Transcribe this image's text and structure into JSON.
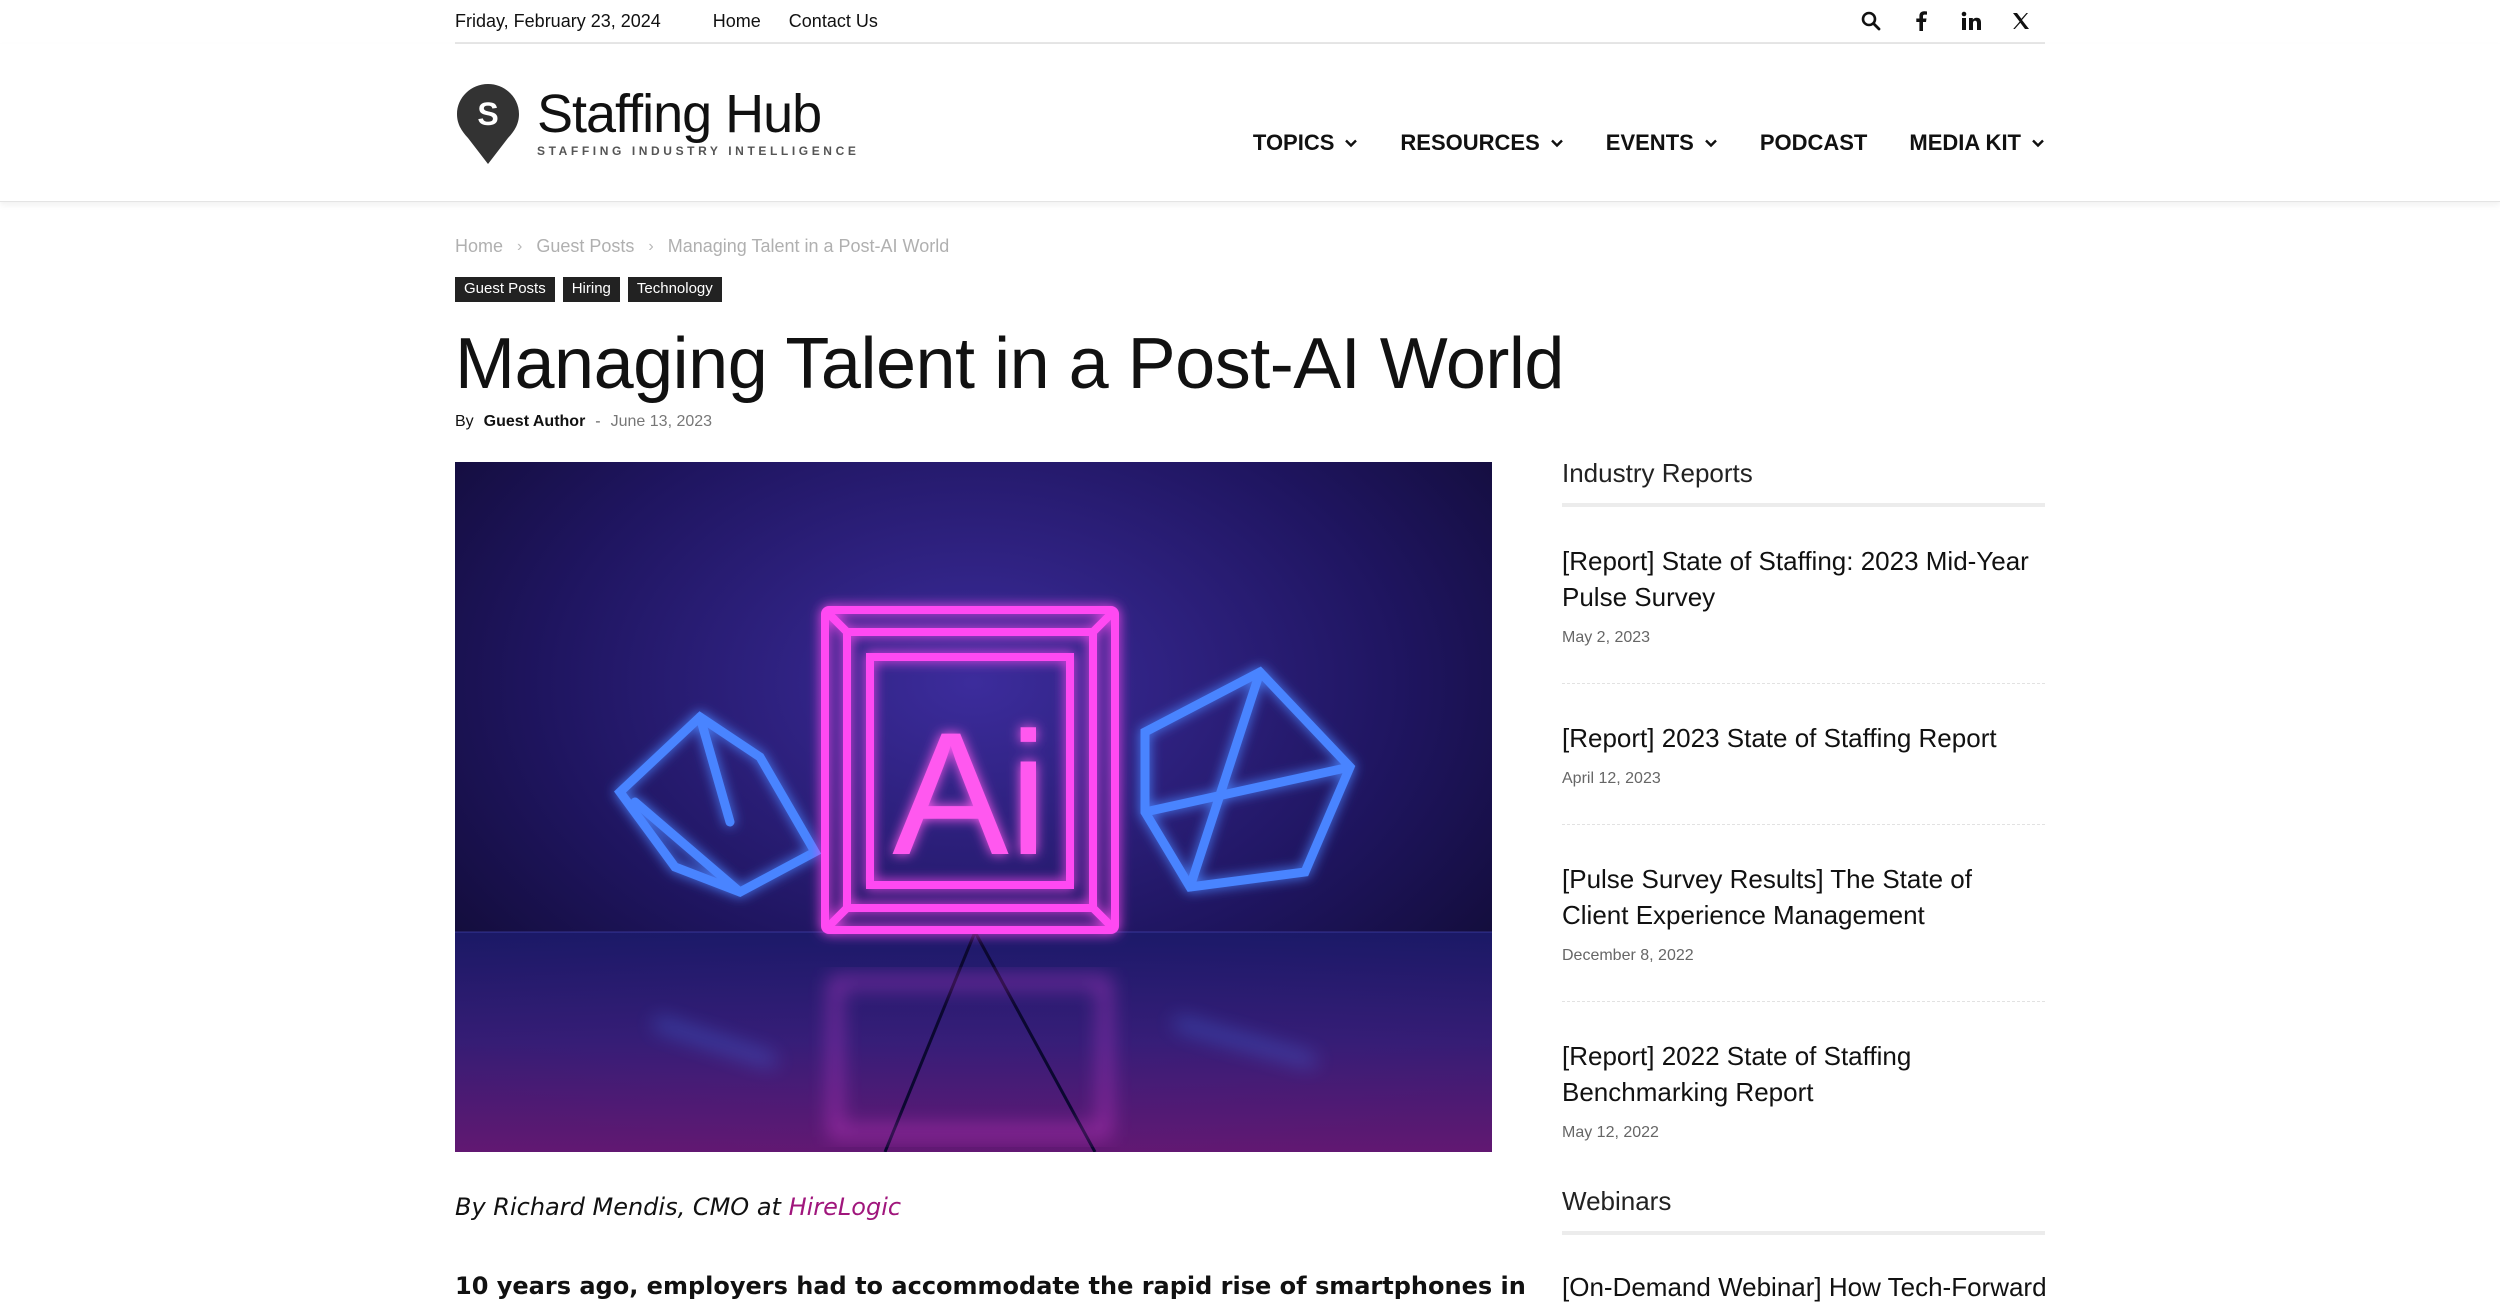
{
  "topbar": {
    "date": "Friday, February 23, 2024",
    "links": [
      "Home",
      "Contact Us"
    ],
    "social_icons": [
      "search-icon",
      "facebook-icon",
      "linkedin-icon",
      "x-icon"
    ]
  },
  "header": {
    "logo_letter": "S",
    "logo_name": "Staffing Hub",
    "logo_tagline": "STAFFING INDUSTRY INTELLIGENCE",
    "nav": [
      {
        "label": "TOPICS",
        "dropdown": true
      },
      {
        "label": "RESOURCES",
        "dropdown": true
      },
      {
        "label": "EVENTS",
        "dropdown": true
      },
      {
        "label": "PODCAST",
        "dropdown": false
      },
      {
        "label": "MEDIA KIT",
        "dropdown": true
      }
    ]
  },
  "breadcrumb": [
    "Home",
    "Guest Posts",
    "Managing Talent in a Post-AI World"
  ],
  "tags": [
    "Guest Posts",
    "Hiring",
    "Technology"
  ],
  "article": {
    "title": "Managing Talent in a Post-AI World",
    "by": "By",
    "author": "Guest Author",
    "dash": "-",
    "date": "June 13, 2023",
    "hero_text": "Ai",
    "lede_prefix": "By Richard Mendis, CMO at ",
    "lede_link": "HireLogic",
    "first_paragraph": "10 years ago, employers had to accommodate the rapid rise of smartphones in"
  },
  "sidebar": {
    "reports_title": "Industry Reports",
    "reports": [
      {
        "title": "[Report] State of Staffing: 2023 Mid-Year Pulse Survey",
        "date": "May 2, 2023"
      },
      {
        "title": "[Report] 2023 State of Staffing Report",
        "date": "April 12, 2023"
      },
      {
        "title": "[Pulse Survey Results] The State of Client Experience Management",
        "date": "December 8, 2022"
      },
      {
        "title": "[Report] 2022 State of Staffing Benchmarking Report",
        "date": "May 12, 2022"
      }
    ],
    "webinars_title": "Webinars",
    "webinar_first": "[On-Demand Webinar] How Tech-Forward"
  },
  "colors": {
    "link_accent": "#a0167c",
    "tag_bg": "#222222",
    "neon_pink": "#ff3df0",
    "neon_blue": "#3a7bff"
  }
}
